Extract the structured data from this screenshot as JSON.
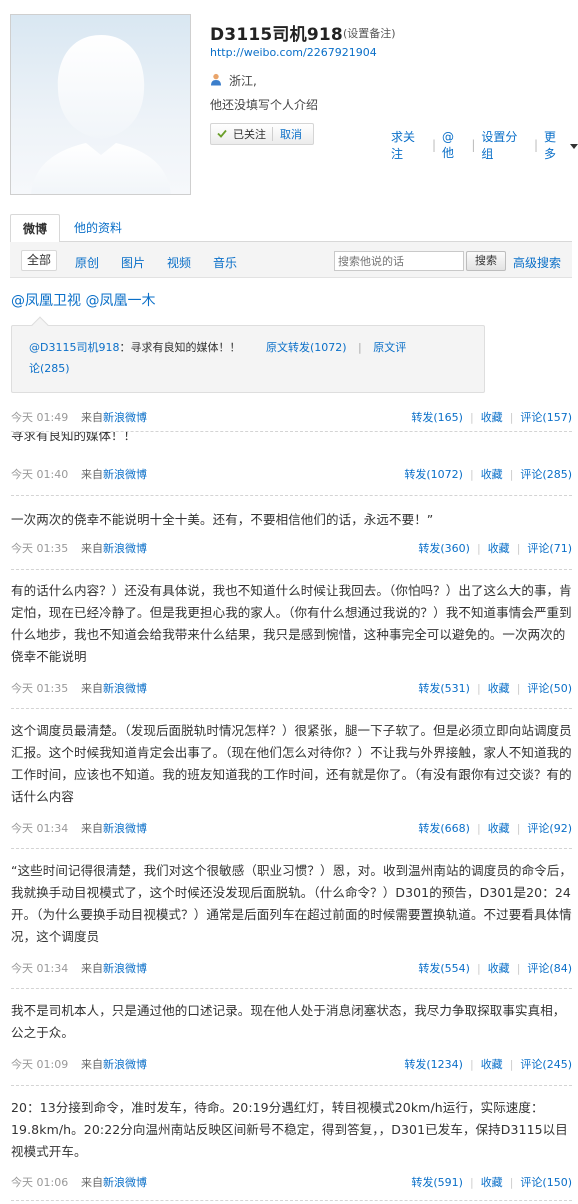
{
  "profile": {
    "name": "D3115司机918",
    "remark_link": "(设置备注)",
    "url": "http://weibo.com/2267921904",
    "location": "浙江,",
    "bio": "他还没填写个人介绍",
    "follow_state": "已关注",
    "unfollow": "取消",
    "actions": [
      "求关注",
      "@他",
      "设置分组",
      "更多"
    ]
  },
  "tabs": {
    "weibo": "微博",
    "profile_info": "他的资料"
  },
  "filters": {
    "items": [
      "全部",
      "原创",
      "图片",
      "视频",
      "音乐"
    ],
    "search_placeholder": "搜索他说的话",
    "search_button": "搜索",
    "advanced": "高级搜索"
  },
  "feed": {
    "first_post": {
      "mentions": "@凤凰卫视 @凤凰一木",
      "quote": {
        "author": "@D3115司机918",
        "text": "：寻求有良知的媒体！！",
        "repost": "原文转发(1072)",
        "comment_part1": "原文评",
        "comment_part2": "论(285)"
      },
      "time": "今天 01:49",
      "source_prefix": "来自",
      "source": "新浪微博",
      "repost": "转发(165)",
      "favorite": "收藏",
      "comment": "评论(157)"
    },
    "posts": [
      {
        "text": "寻求有良知的媒体！！",
        "time": "今天 01:40",
        "source_prefix": "来自",
        "source": "新浪微博",
        "repost": "转发(1072)",
        "favorite": "收藏",
        "comment": "评论(285)"
      },
      {
        "text": "一次两次的侥幸不能说明十全十美。还有，不要相信他们的话，永远不要！”",
        "time": "今天 01:35",
        "source_prefix": "来自",
        "source": "新浪微博",
        "repost": "转发(360)",
        "favorite": "收藏",
        "comment": "评论(71)"
      },
      {
        "text": "有的话什么内容？）还没有具体说，我也不知道什么时候让我回去。（你怕吗？）出了这么大的事，肯定怕，现在已经冷静了。但是我更担心我的家人。（你有什么想通过我说的？）我不知道事情会严重到什么地步，我也不知道会给我带来什么结果，我只是感到惋惜，这种事完全可以避免的。一次两次的侥幸不能说明",
        "time": "今天 01:35",
        "source_prefix": "来自",
        "source": "新浪微博",
        "repost": "转发(531)",
        "favorite": "收藏",
        "comment": "评论(50)"
      },
      {
        "text": "这个调度员最清楚。（发现后面脱轨时情况怎样？）很紧张，腿一下子软了。但是必须立即向站调度员汇报。这个时候我知道肯定会出事了。（现在他们怎么对待你？）不让我与外界接触，家人不知道我的工作时间，应该也不知道。我的班友知道我的工作时间，还有就是你了。（有没有跟你有过交谈？有的话什么内容",
        "time": "今天 01:34",
        "source_prefix": "来自",
        "source": "新浪微博",
        "repost": "转发(668)",
        "favorite": "收藏",
        "comment": "评论(92)"
      },
      {
        "text": "“这些时间记得很清楚，我们对这个很敏感（职业习惯？）恩，对。收到温州南站的调度员的命令后，我就换手动目视模式了，这个时候还没发现后面脱轨。（什么命令？）D301的预告，D301是20：24开。（为什么要换手动目视模式？）通常是后面列车在超过前面的时候需要置换轨道。不过要看具体情况，这个调度员",
        "time": "今天 01:34",
        "source_prefix": "来自",
        "source": "新浪微博",
        "repost": "转发(554)",
        "favorite": "收藏",
        "comment": "评论(84)"
      },
      {
        "text": "我不是司机本人，只是通过他的口述记录。现在他人处于消息闭塞状态，我尽力争取探取事实真相，公之于众。",
        "time": "今天 01:09",
        "source_prefix": "来自",
        "source": "新浪微博",
        "repost": "转发(1234)",
        "favorite": "收藏",
        "comment": "评论(245)"
      },
      {
        "text": "20：13分接到命令，准时发车，待命。20:19分遇红灯，转目视模式20km/h运行，实际速度：19.8km/h。20:22分向温州南站反映区间新号不稳定，得到答复，，D301已发车，保持D3115以目视模式开车。",
        "time": "今天 01:06",
        "source_prefix": "来自",
        "source": "新浪微博",
        "repost": "转发(591)",
        "favorite": "收藏",
        "comment": "评论(150)"
      }
    ]
  }
}
